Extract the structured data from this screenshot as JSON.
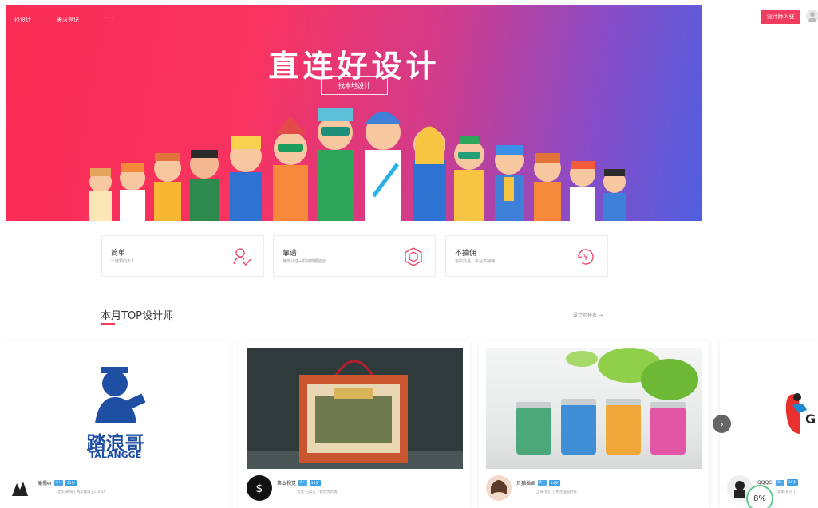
{
  "nav": {
    "items": [
      "找设计",
      "需求登记"
    ],
    "more": "···"
  },
  "hero": {
    "title": "直连好设计",
    "button": "找本地设计"
  },
  "header": {
    "join_button": "设计师入驻"
  },
  "features": [
    {
      "title": "简单",
      "subtitle": "一键预约多人",
      "icon": "user-check-icon"
    },
    {
      "title": "靠谱",
      "subtitle": "身份认证+实战数据验证",
      "icon": "hexagon-icon"
    },
    {
      "title": "不抽佣",
      "subtitle": "自由交易，平台不抽佣",
      "icon": "yen-refresh-icon"
    }
  ],
  "section": {
    "title": "本月TOP设计师",
    "more_link": "设计师排名 →"
  },
  "cards": [
    {
      "name": "瑜儒er",
      "level": "6+",
      "years": "25岁",
      "meta": "北京·朝阳 | 两次踏浪王LOGO",
      "logo_text": "踏浪哥",
      "logo_sub": "TALANGGE"
    },
    {
      "name": "第本视觉",
      "level": "6+",
      "years": "36岁",
      "meta": "河北·石家庄 | 视觉传达者"
    },
    {
      "name": "贝猫插画",
      "level": "6+",
      "years": "34岁",
      "meta": "上海·徐汇 | 专注插画创作"
    },
    {
      "name": "QQQCi",
      "level": "6+",
      "years": "36岁",
      "meta": "湖南·长沙 |",
      "logo_text": "G"
    }
  ],
  "progress": {
    "value": "8%"
  },
  "colors": {
    "accent": "#f03d5f",
    "badge": "#3aa0e6"
  }
}
